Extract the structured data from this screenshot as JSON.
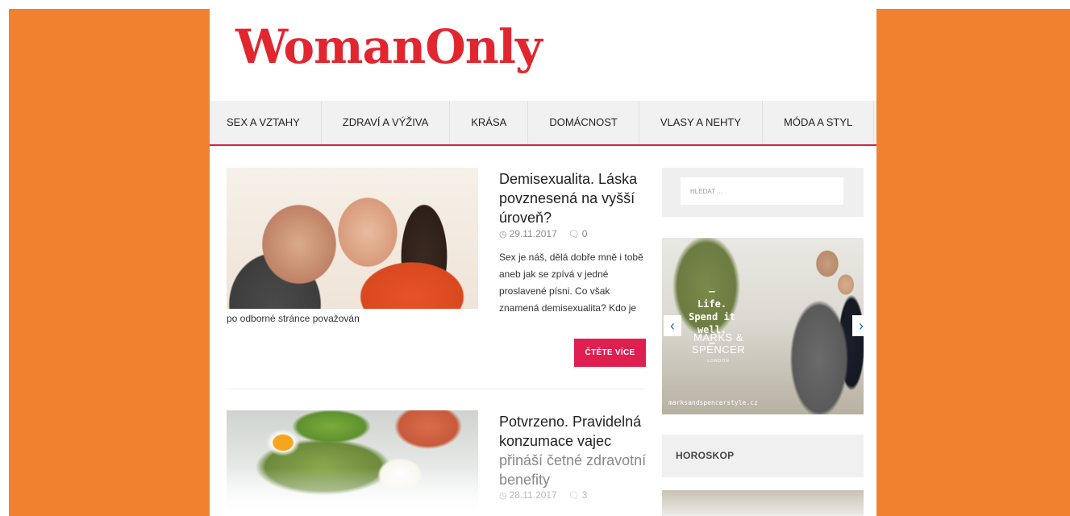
{
  "site": {
    "logo_text": "WomanOnly",
    "brand_color": "#e2262f",
    "background_color": "#f0812f"
  },
  "nav": {
    "items": [
      {
        "label": "SEX A VZTAHY"
      },
      {
        "label": "ZDRAVÍ A VÝŽIVA"
      },
      {
        "label": "KRÁSA"
      },
      {
        "label": "DOMÁCNOST"
      },
      {
        "label": "VLASY A NEHTY"
      },
      {
        "label": "MÓDA A STYL"
      }
    ]
  },
  "articles": [
    {
      "title": "Demisexualita. Láska povznesená na vyšší úroveň?",
      "date": "29.11.2017",
      "comments": "0",
      "excerpt": "Sex je náš, dělá dobře mně i tobě aneb jak se zpívá v jedné proslavené písni. Co však znamená demisexualita? Kdo je",
      "excerpt_tail": "po odborné stránce považován",
      "read_more": "ČTĚTE VÍCE",
      "image_icon": "couple-photo"
    },
    {
      "title_main": "Potvrzeno. Pravidelná konzumace vajec",
      "title_fade": "přináší četné zdravotní benefity",
      "date": "28.11.2017",
      "comments": "3",
      "image_icon": "food-photo"
    }
  ],
  "sidebar": {
    "search_placeholder": "HLEDAT ...",
    "ad": {
      "slogan_line1": "—",
      "slogan_line2": "Life.",
      "slogan_line3": "Spend it well.",
      "slogan_line4": "—",
      "brand_line1": "MARKS &",
      "brand_line2": "SPENCER",
      "brand_sub": "LONDON",
      "url": "marksandspencerstyle.cz",
      "prev_icon": "chevron-left-icon",
      "next_icon": "chevron-right-icon"
    },
    "horoscope_title": "HOROSKOP"
  }
}
